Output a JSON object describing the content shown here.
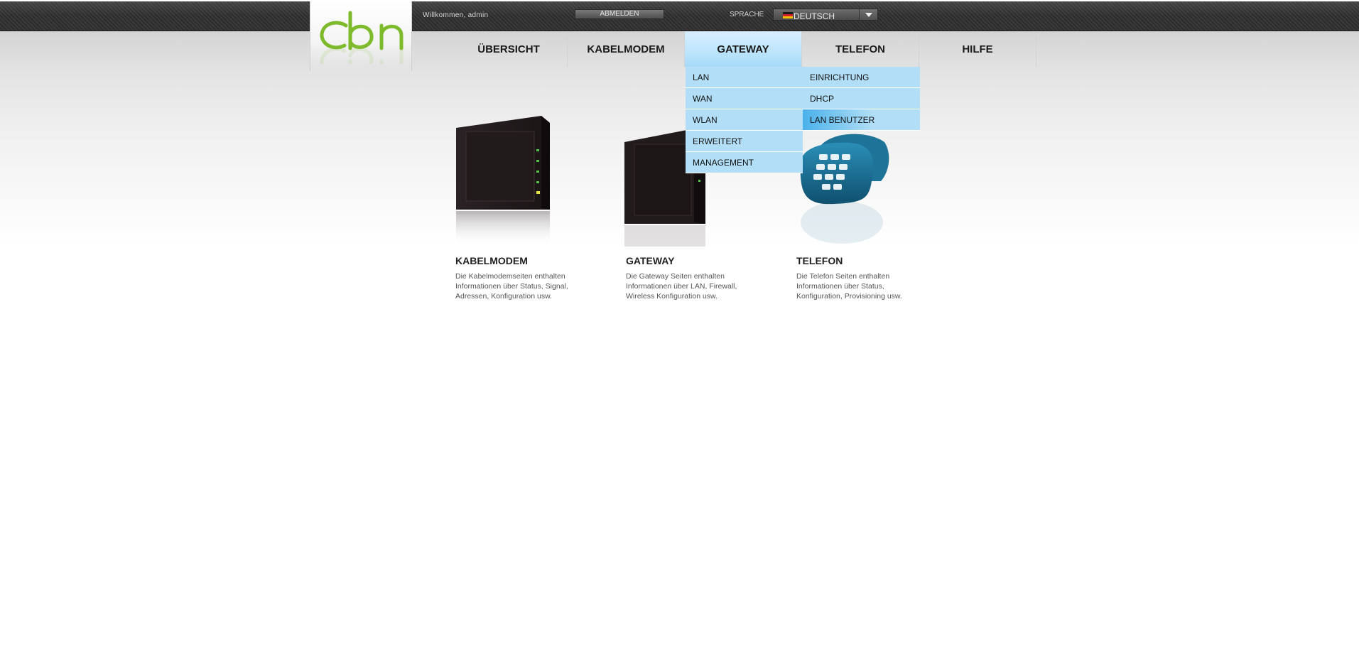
{
  "header": {
    "welcome_text": "Willkommen, admin",
    "logout_label": "ABMELDEN",
    "language_label": "SPRACHE",
    "language_value": "DEUTSCH"
  },
  "logo": {
    "brand_text": "cbn",
    "brand_color": "#7dbb2c"
  },
  "nav": {
    "items": [
      {
        "label": "ÜBERSICHT"
      },
      {
        "label": "KABELMODEM"
      },
      {
        "label": "GATEWAY"
      },
      {
        "label": "TELEFON"
      },
      {
        "label": "HILFE"
      }
    ],
    "active": "GATEWAY"
  },
  "dropdown": {
    "left": [
      "LAN",
      "WAN",
      "WLAN",
      "ERWEITERT",
      "MANAGEMENT"
    ],
    "right": [
      "EINRICHTUNG",
      "DHCP",
      "LAN BENUTZER"
    ],
    "highlighted": "LAN BENUTZER"
  },
  "tiles": [
    {
      "title": "KABELMODEM",
      "desc": "Die Kabelmodemseiten enthalten Informationen über Status, Signal, Adressen, Konfiguration usw.",
      "icon": "cable-modem-device"
    },
    {
      "title": "GATEWAY",
      "desc": "Die Gateway Seiten enthalten Informationen über LAN, Firewall, Wireless Konfiguration usw.",
      "icon": "gateway-device"
    },
    {
      "title": "TELEFON",
      "desc": "Die Telefon Seiten enthalten Informationen über Status, Konfiguration, Provisioning usw.",
      "icon": "telephone"
    }
  ],
  "colors": {
    "accent_blue": "#4ab1ea",
    "menu_blue": "#b2dff7",
    "topbar": "#333333"
  }
}
